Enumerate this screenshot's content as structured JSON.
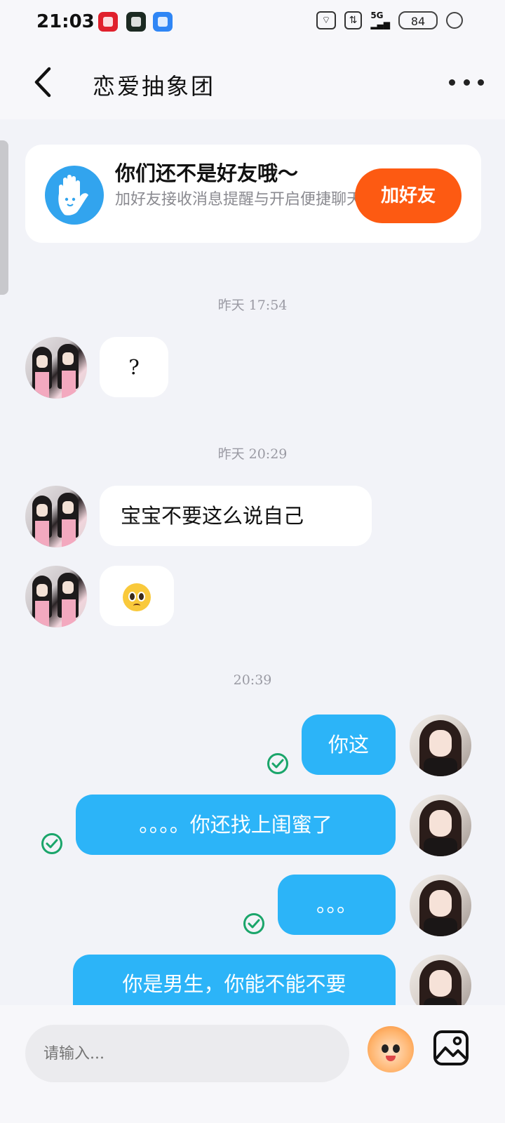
{
  "status_bar": {
    "time": "21:03",
    "network": "5G",
    "battery": "84"
  },
  "header": {
    "back_icon": "chevron-left-icon",
    "title": "恋爱抽象团",
    "more_icon": "more-horizontal-icon"
  },
  "friend_card": {
    "icon": "hand-wave-icon",
    "title": "你们还不是好友哦～",
    "subtitle": "加好友接收消息提醒与开启便捷聊天",
    "button_label": "加好友",
    "button_color": "#fd5a12"
  },
  "messages": {
    "ts1": "昨天 17:54",
    "m1": "?",
    "ts2": "昨天 20:29",
    "m2": "宝宝不要这么说自己",
    "m3_emoji": "pleading-face-emoji",
    "ts3": "20:39",
    "m4": "你这",
    "m5": "。。。。你还找上闺蜜了",
    "m6": "。。。",
    "m7": "你是男生，你能不能不要"
  },
  "input": {
    "placeholder": "请输入...",
    "mascot_icon": "mascot-emoji-icon",
    "image_icon": "image-icon"
  },
  "colors": {
    "outgoing_bubble": "#2cb4f8",
    "read_check": "#1aa56a",
    "background": "#f2f3f8"
  }
}
